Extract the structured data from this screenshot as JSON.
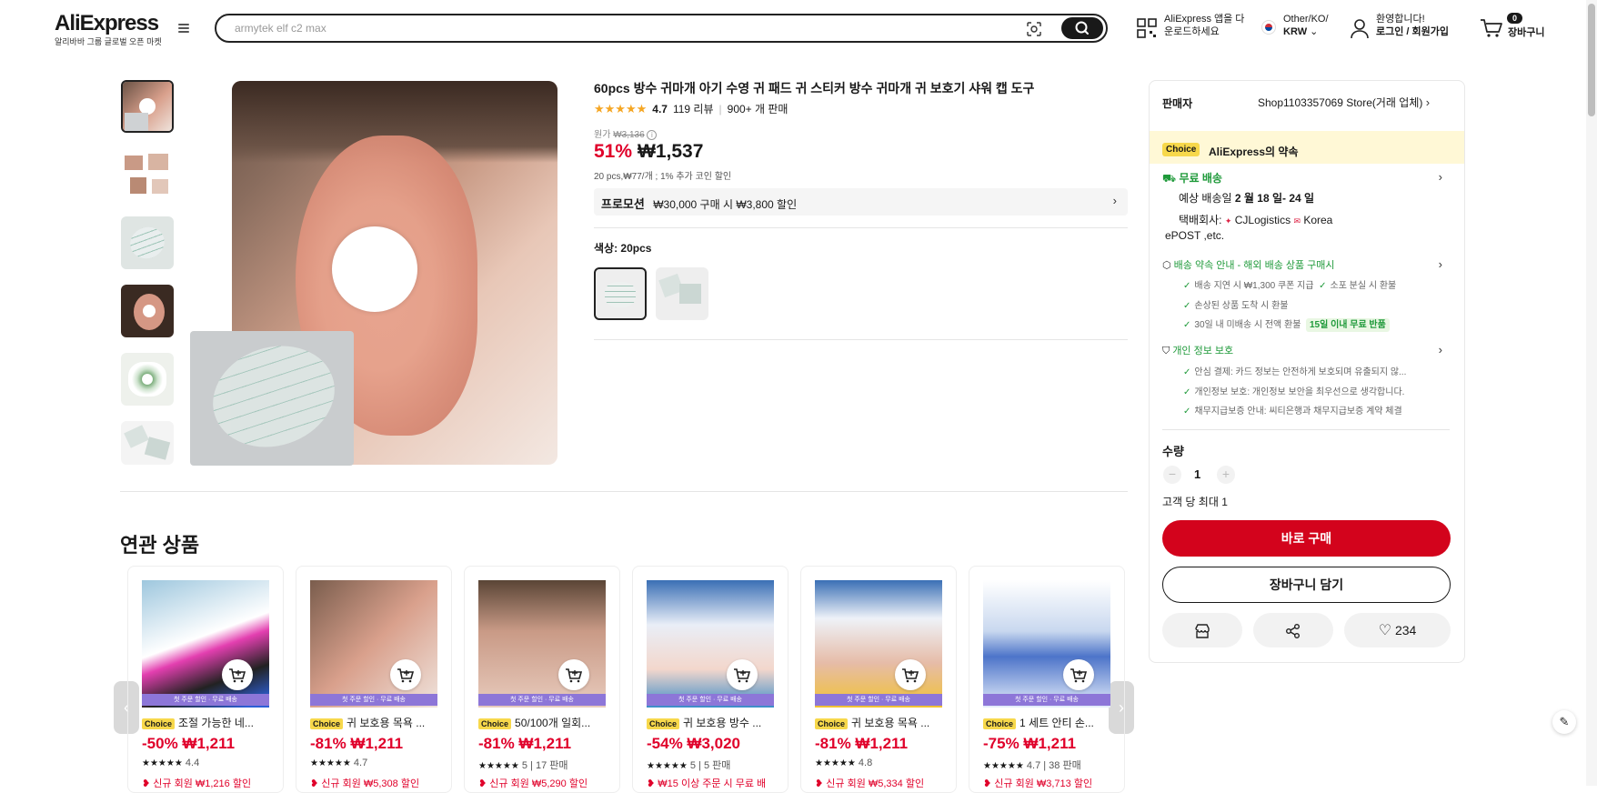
{
  "header": {
    "logo": "AliExpress",
    "logo_sub": "알리바바 그룹 글로벌 오픈 마켓",
    "search_placeholder": "armytek elf c2 max",
    "app_line1": "AliExpress 앱을 다",
    "app_line2": "운로드하세요",
    "locale_line1": "Other/KO/",
    "locale_line2": "KRW",
    "account_line1": "환영합니다!",
    "account_line2": "로그인 / 회원가입",
    "cart_count": "0",
    "cart_label": "장바구니"
  },
  "product": {
    "title": "60pcs 방수 귀마개 아기 수영 귀 패드 귀 스티커 방수 귀마개 귀 보호기 샤워 캡 도구",
    "rating": "4.7",
    "reviews": "119 리뷰",
    "sold": "900+ 개 판매",
    "original_price_label": "원가",
    "original_price": "₩3,136",
    "discount": "51%",
    "price": "₩1,537",
    "unit_info": "20 pcs,₩77/개 ; 1% 추가 코인 할인",
    "promo_label": "프로모션",
    "promo_text": "₩30,000 구매 시 ₩3,800 할인",
    "color_label": "색상: 20pcs"
  },
  "panel": {
    "seller_label": "판매자",
    "store_name": "Shop1103357069 Store(거래 업체)",
    "choice_tag": "Choice",
    "choice_promise": "AliExpress의 약속",
    "shipping_title": "무료 배송",
    "delivery_prefix": "예상 배송일",
    "delivery_date": "2 월 18 일- 24 일",
    "carrier_prefix": "택배회사:",
    "carrier1": "CJLogistics",
    "carrier2": "Korea",
    "carrier3": "ePOST ,etc.",
    "promise_title": "배송 약속 안내 - 해외 배송 상품 구매시",
    "promise_items": [
      "배송 지연 시 ₩1,300 쿠폰 지급",
      "소포 분실 시 환불",
      "손상된 상품 도착 시 환불",
      "30일 내 미배송 시 전액 환불"
    ],
    "refund_badge": "15일 이내 무료 반품",
    "privacy_title": "개인 정보 보호",
    "privacy_items": [
      "안심 결제: 카드 정보는 안전하게 보호되며 유출되지 않...",
      "개인정보 보호: 개인정보 보안을 최우선으로 생각합니다.",
      "채무지급보증 안내: 씨티은행과 채무지급보증 계약 체결"
    ],
    "qty_label": "수량",
    "qty_value": "1",
    "qty_limit": "고객 당 최대 1",
    "buy_now": "바로 구매",
    "add_cart": "장바구니 담기",
    "wishlist_count": "234"
  },
  "related": {
    "title": "연관 상품",
    "strip_text": "첫 주문 할인 · 무료 배송",
    "items": [
      {
        "name": "조절 가능한 네...",
        "discount": "-50%",
        "price": "₩1,211",
        "rating": "4.4",
        "sold": "",
        "coupon": "신규 회원 ₩1,216 할인"
      },
      {
        "name": "귀 보호용 목욕 ...",
        "discount": "-81%",
        "price": "₩1,211",
        "rating": "4.7",
        "sold": "",
        "coupon": "신규 회원 ₩5,308 할인"
      },
      {
        "name": "50/100개 일회...",
        "discount": "-81%",
        "price": "₩1,211",
        "rating": "5",
        "sold": "| 17 판매",
        "coupon": "신규 회원 ₩5,290 할인"
      },
      {
        "name": "귀 보호용 방수 ...",
        "discount": "-54%",
        "price": "₩3,020",
        "rating": "5",
        "sold": "| 5 판매",
        "coupon": "₩15 이상 주문 시 무료 배"
      },
      {
        "name": "귀 보호용 목욕 ...",
        "discount": "-81%",
        "price": "₩1,211",
        "rating": "4.8",
        "sold": "",
        "coupon": "신규 회원 ₩5,334 할인"
      },
      {
        "name": "1 세트 안티 손...",
        "discount": "-75%",
        "price": "₩1,211",
        "rating": "4.7",
        "sold": "| 38 판매",
        "coupon": "신규 회원 ₩3,713 할인"
      }
    ]
  },
  "colors": {
    "brand_red": "#e0002a",
    "buy_red": "#d3031c",
    "choice_yellow": "#f7d84b",
    "green": "#1f9a3a"
  }
}
